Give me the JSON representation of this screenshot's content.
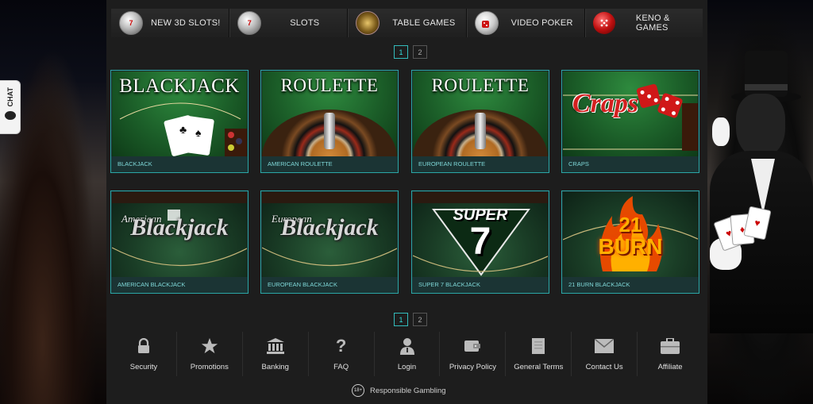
{
  "chat_tab": {
    "label": "CHAT"
  },
  "nav": [
    {
      "label": "NEW 3D SLOTS!",
      "icon": "slot-machine-icon",
      "icon_text": "7"
    },
    {
      "label": "SLOTS",
      "icon": "slot-machine-icon",
      "icon_text": "7"
    },
    {
      "label": "TABLE GAMES",
      "icon": "table-games-icon",
      "icon_text": ""
    },
    {
      "label": "VIDEO POKER",
      "icon": "dice-icon",
      "icon_text": ""
    },
    {
      "label": "KENO & GAMES",
      "icon": "keno-icon",
      "icon_text": ""
    }
  ],
  "pager": {
    "pages": [
      "1",
      "2"
    ],
    "active": "1"
  },
  "games": [
    {
      "title": "BLACKJACK",
      "caption": "BLACKJACK"
    },
    {
      "title": "ROULETTE",
      "caption": "AMERICAN ROULETTE"
    },
    {
      "title": "ROULETTE",
      "caption": "EUROPEAN ROULETTE"
    },
    {
      "title": "Craps",
      "caption": "CRAPS"
    },
    {
      "title_small": "American",
      "title": "Blackjack",
      "caption": "AMERICAN BLACKJACK"
    },
    {
      "title_small": "European",
      "title": "Blackjack",
      "caption": "EUROPEAN BLACKJACK"
    },
    {
      "title_small": "SUPER",
      "title": "7",
      "caption": "SUPER 7 BLACKJACK"
    },
    {
      "title_small": "21",
      "title": "BURN",
      "caption": "21 BURN BLACKJACK"
    }
  ],
  "footer": [
    {
      "label": "Security",
      "icon": "lock-icon"
    },
    {
      "label": "Promotions",
      "icon": "star-icon"
    },
    {
      "label": "Banking",
      "icon": "bank-icon"
    },
    {
      "label": "FAQ",
      "icon": "question-icon"
    },
    {
      "label": "Login",
      "icon": "user-icon"
    },
    {
      "label": "Privacy Policy",
      "icon": "wallet-icon"
    },
    {
      "label": "General Terms",
      "icon": "document-icon"
    },
    {
      "label": "Contact Us",
      "icon": "envelope-icon"
    },
    {
      "label": "Affiliate",
      "icon": "briefcase-icon"
    }
  ],
  "responsible": {
    "badge": "18+",
    "label": "Responsible Gambling"
  },
  "colors": {
    "accent": "#2aa7a7",
    "caption_text": "#7fd8d8",
    "panel": "#1d1d1d"
  }
}
